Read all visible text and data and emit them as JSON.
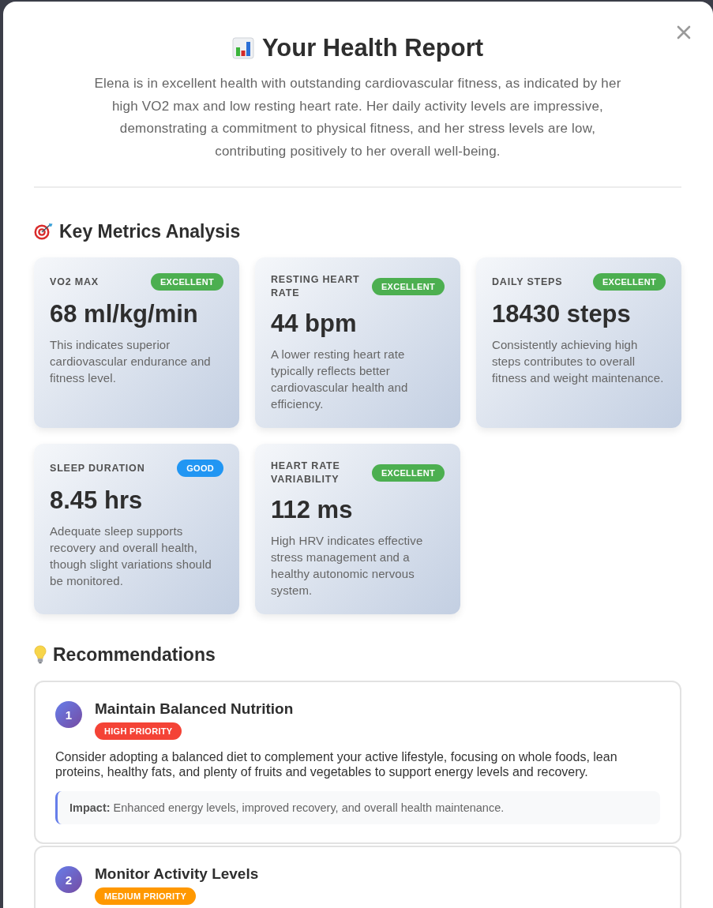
{
  "report": {
    "title": "Your Health Report",
    "summary": "Elena is in excellent health with outstanding cardiovascular fitness, as indicated by her high VO2 max and low resting heart rate. Her daily activity levels are impressive, demonstrating a commitment to physical fitness, and her stress levels are low, contributing positively to her overall well-being."
  },
  "metrics_section": {
    "heading": "Key Metrics Analysis",
    "metrics": [
      {
        "label": "VO2 MAX",
        "rating": {
          "text": "EXCELLENT",
          "color": "#4caf50"
        },
        "value": "68 ml/kg/min",
        "description": "This indicates superior cardiovascular endurance and fitness level."
      },
      {
        "label": "RESTING HEART RATE",
        "rating": {
          "text": "EXCELLENT",
          "color": "#4caf50"
        },
        "value": "44 bpm",
        "description": "A lower resting heart rate typically reflects better cardiovascular health and efficiency."
      },
      {
        "label": "DAILY STEPS",
        "rating": {
          "text": "EXCELLENT",
          "color": "#4caf50"
        },
        "value": "18430 steps",
        "description": "Consistently achieving high steps contributes to overall fitness and weight maintenance."
      },
      {
        "label": "SLEEP DURATION",
        "rating": {
          "text": "GOOD",
          "color": "#2196f3"
        },
        "value": "8.45 hrs",
        "description": "Adequate sleep supports recovery and overall health, though slight variations should be monitored."
      },
      {
        "label": "HEART RATE VARIABILITY",
        "rating": {
          "text": "EXCELLENT",
          "color": "#4caf50"
        },
        "value": "112 ms",
        "description": "High HRV indicates effective stress management and a healthy autonomic nervous system."
      }
    ]
  },
  "recommendations_section": {
    "heading": "Recommendations",
    "items": [
      {
        "number": "1",
        "title": "Maintain Balanced Nutrition",
        "priority": {
          "text": "HIGH PRIORITY",
          "color": "#f44336"
        },
        "description": "Consider adopting a balanced diet to complement your active lifestyle, focusing on whole foods, lean proteins, healthy fats, and plenty of fruits and vegetables to support energy levels and recovery.",
        "impact": "**Impact:** Enhanced energy levels, improved recovery, and overall health maintenance."
      },
      {
        "number": "2",
        "title": "Monitor Activity Levels",
        "priority": {
          "text": "MEDIUM PRIORITY",
          "color": "#ff9800"
        }
      }
    ]
  }
}
